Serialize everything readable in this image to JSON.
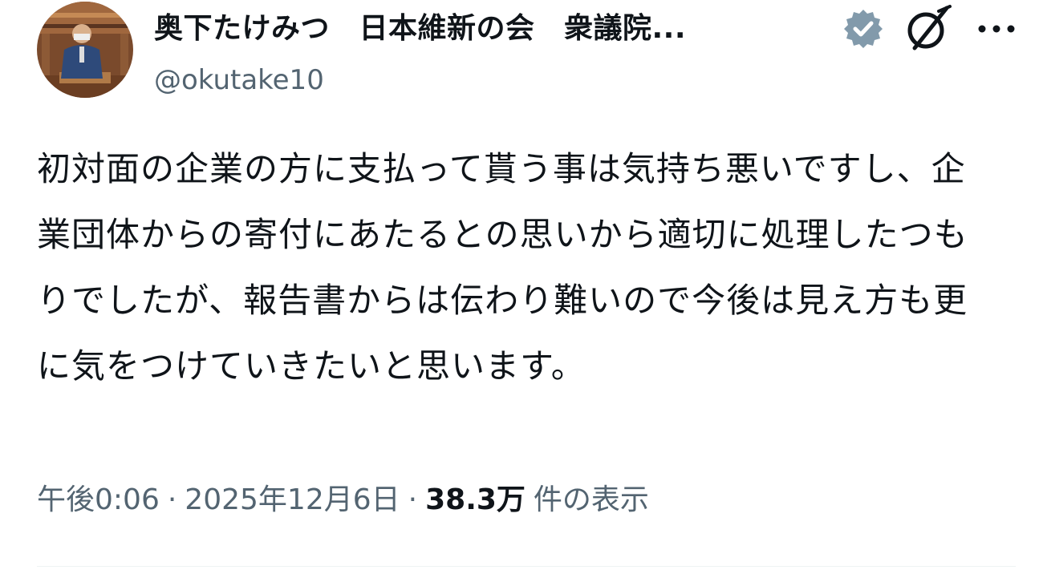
{
  "author": {
    "display_name": "奥下たけみつ　日本維新の会　衆議院...",
    "handle": "@okutake10",
    "verified_color": "#829aab"
  },
  "icons": {
    "avatar": "avatar-photo",
    "verified": "verified-badge-icon",
    "grok": "grok-icon",
    "more": "more-icon"
  },
  "tweet": {
    "text": "初対面の企業の方に支払って貰う事は気持ち悪いですし、企業団体からの寄付にあたるとの思いから適切に処理したつもりでしたが、報告書からは伝わり難いので今後は見え方も更に気をつけていきたいと思います。"
  },
  "meta": {
    "time": "午後0:06",
    "separator": "·",
    "date": "2025年12月6日",
    "views_count": "38.3万",
    "views_label": "件の表示"
  },
  "colors": {
    "text_primary": "#0f1419",
    "text_secondary": "#536471",
    "divider": "#eff3f4"
  }
}
